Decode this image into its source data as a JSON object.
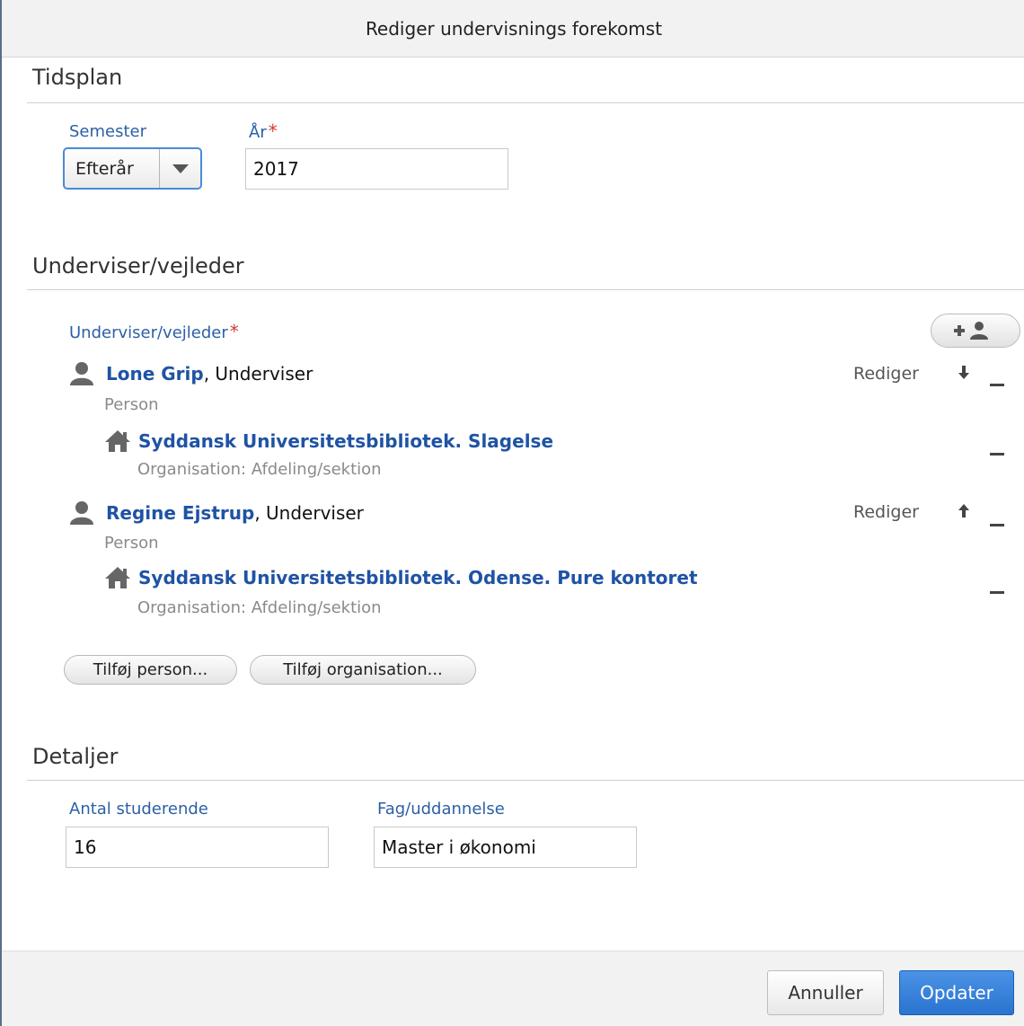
{
  "dialog": {
    "title": "Rediger undervisnings forekomst"
  },
  "schedule": {
    "title": "Tidsplan",
    "semester_label": "Semester",
    "semester_value": "Efterår",
    "year_label": "År",
    "year_required": "*",
    "year_value": "2017"
  },
  "teachers": {
    "title": "Underviser/vejleder",
    "field_label": "Underviser/vejleder",
    "required": "*",
    "entries": [
      {
        "name": "Lone Grip",
        "role": ", Underviser",
        "type": "Person",
        "edit": "Rediger",
        "move_icon": "arrow-down",
        "org_name": "Syddansk Universitetsbibliotek. Slagelse",
        "org_type": "Organisation: Afdeling/sektion"
      },
      {
        "name": "Regine Ejstrup",
        "role": ", Underviser",
        "type": "Person",
        "edit": "Rediger",
        "move_icon": "arrow-up",
        "org_name": "Syddansk Universitetsbibliotek. Odense. Pure kontoret",
        "org_type": "Organisation: Afdeling/sektion"
      }
    ],
    "add_person": "Tilføj person...",
    "add_org": "Tilføj organisation..."
  },
  "details": {
    "title": "Detaljer",
    "students_label": "Antal studerende",
    "students_value": "16",
    "subject_label": "Fag/uddannelse",
    "subject_value": "Master i økonomi"
  },
  "footer": {
    "cancel": "Annuller",
    "update": "Opdater"
  },
  "colors": {
    "link": "#1f53a4",
    "label": "#2c5fa6",
    "required": "#d43a3a",
    "primary": "#2a73cf"
  }
}
